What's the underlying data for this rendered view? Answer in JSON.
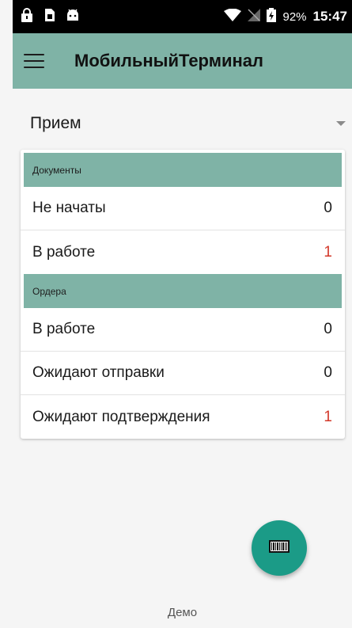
{
  "status_bar": {
    "battery": "92%",
    "time": "15:47",
    "icons": [
      "lock-icon",
      "sim-card-icon",
      "android-icon",
      "wifi-icon",
      "no-sim-icon",
      "battery-charging-icon"
    ]
  },
  "app_bar": {
    "title": "МобильныйТерминал",
    "menu_icon": "hamburger-menu-icon"
  },
  "mode_selector": {
    "selected": "Прием"
  },
  "sections": [
    {
      "header": "Документы",
      "rows": [
        {
          "label": "Не начаты",
          "value": "0",
          "highlight": false
        },
        {
          "label": "В работе",
          "value": "1",
          "highlight": true
        }
      ]
    },
    {
      "header": "Ордера",
      "rows": [
        {
          "label": "В работе",
          "value": "0",
          "highlight": false
        },
        {
          "label": "Ожидают отправки",
          "value": "0",
          "highlight": false
        },
        {
          "label": "Ожидают подтверждения",
          "value": "1",
          "highlight": true
        }
      ]
    }
  ],
  "fab": {
    "icon": "barcode-icon"
  },
  "footer": {
    "text": "Демо"
  },
  "colors": {
    "accent": "#7fb3a6",
    "fab": "#1b9b87",
    "highlight_value": "#d3382a"
  }
}
